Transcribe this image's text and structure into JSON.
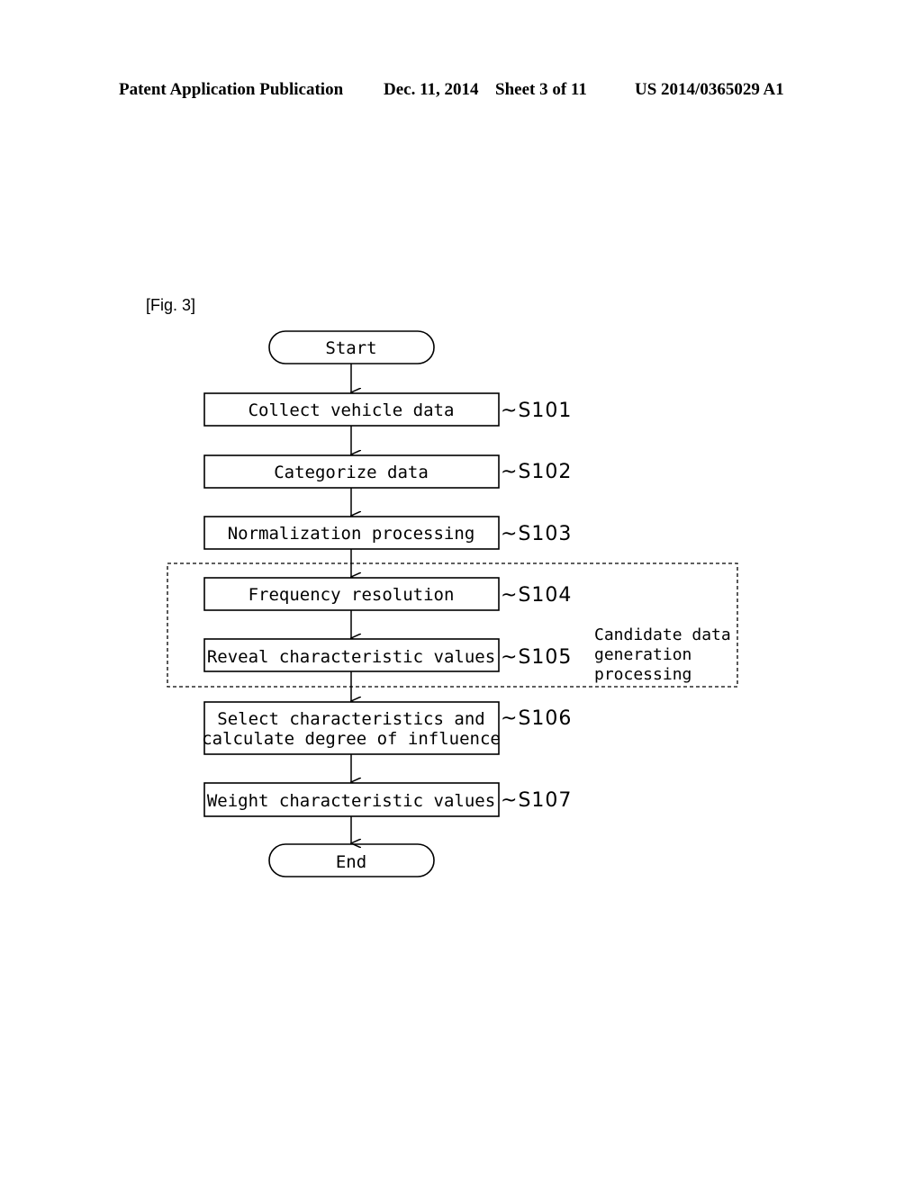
{
  "header": {
    "publication": "Patent Application Publication",
    "date": "Dec. 11, 2014",
    "sheet": "Sheet 3 of 11",
    "number": "US 2014/0365029 A1"
  },
  "figure": {
    "label": "[Fig. 3]",
    "start": "Start",
    "end": "End",
    "steps": [
      {
        "id": "S101",
        "lines": [
          "Collect vehicle data"
        ]
      },
      {
        "id": "S102",
        "lines": [
          "Categorize data"
        ]
      },
      {
        "id": "S103",
        "lines": [
          "Normalization processing"
        ]
      },
      {
        "id": "S104",
        "lines": [
          "Frequency resolution"
        ]
      },
      {
        "id": "S105",
        "lines": [
          "Reveal characteristic values"
        ]
      },
      {
        "id": "S106",
        "lines": [
          "Select characteristics and",
          "calculate degree of influence"
        ]
      },
      {
        "id": "S107",
        "lines": [
          "Weight characteristic values"
        ]
      }
    ],
    "group": {
      "lines": [
        "Candidate data",
        "generation",
        "processing"
      ],
      "contains": [
        "S104",
        "S105"
      ]
    }
  }
}
